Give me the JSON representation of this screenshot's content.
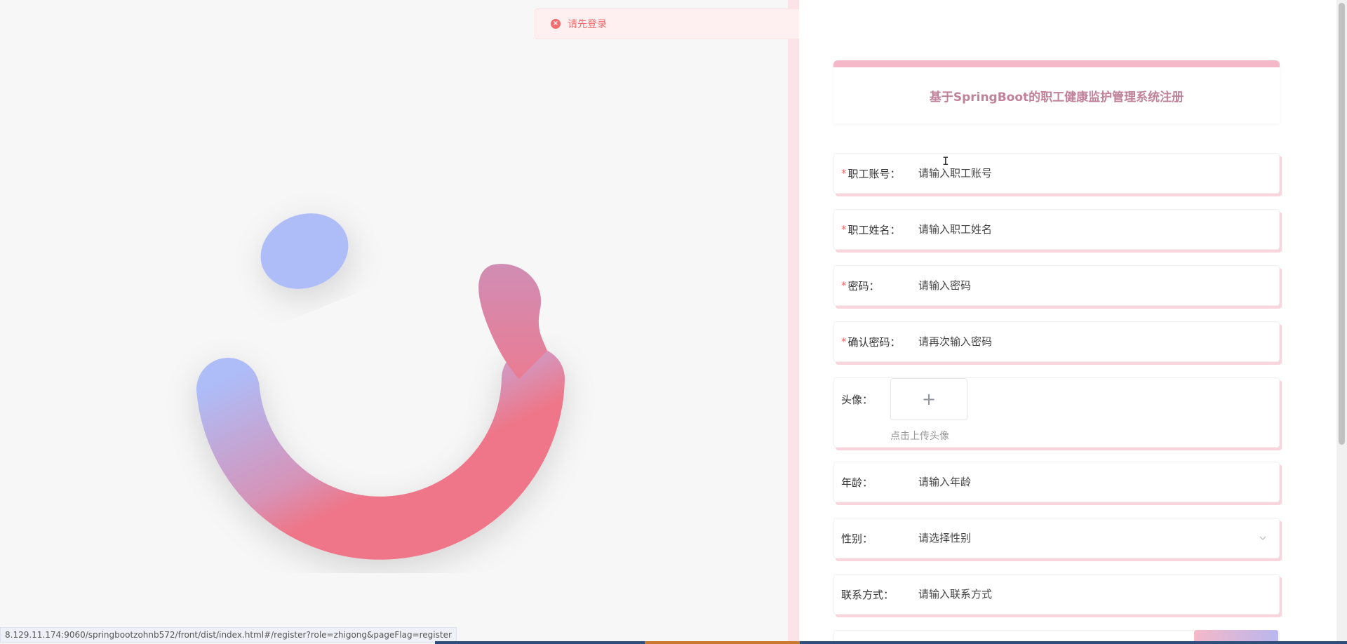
{
  "toast": {
    "message": "请先登录",
    "icon": "close-circle-icon"
  },
  "form": {
    "title": "基于SpringBoot的职工健康监护管理系统注册",
    "fields": [
      {
        "label": "职工账号：",
        "placeholder": "请输入职工账号",
        "required": true
      },
      {
        "label": "职工姓名：",
        "placeholder": "请输入职工姓名",
        "required": true
      },
      {
        "label": "密码：",
        "placeholder": "请输入密码",
        "required": true
      },
      {
        "label": "确认密码：",
        "placeholder": "请再次输入密码",
        "required": true
      }
    ],
    "avatar": {
      "label": "头像：",
      "upload_symbol": "+",
      "hint": "点击上传头像"
    },
    "age": {
      "label": "年龄：",
      "placeholder": "请输入年龄"
    },
    "gender": {
      "label": "性别：",
      "placeholder": "请选择性别",
      "icon": "chevron-down-icon"
    },
    "contact": {
      "label": "联系方式：",
      "placeholder": "请输入联系方式"
    },
    "required_mark": "*"
  },
  "status_bar": {
    "url": "8.129.11.174:9060/springbootzohnb572/front/dist/index.html#/register?role=zhigong&pageFlag=register"
  },
  "colors": {
    "accent_pink": "#f5b8c8",
    "title_color": "#c0829a",
    "error_red": "#f56c6c",
    "gradient_blue": "#aebcf7",
    "gradient_pink": "#ef7688"
  }
}
